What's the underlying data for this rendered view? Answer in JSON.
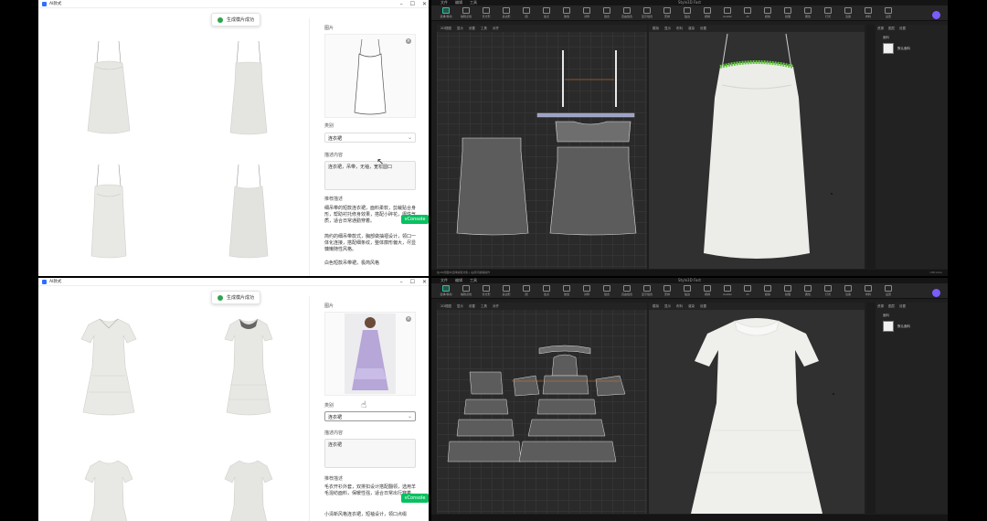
{
  "top": {
    "ai": {
      "title": "AI款式",
      "toast": "生成模片成功",
      "image_label": "图片",
      "category_label": "类别",
      "category_value": "连衣裙",
      "desc_label": "描述内容",
      "desc_value": "连衣裙，吊带，无袖，宽松圆口",
      "rec_label": "推荐描述",
      "rec_texts": [
        "细吊带的短款连衣裙，面料柔软，剪裁贴合身形，帮助衬托修身效果，搭配小碎花，很性气质，适合日常通勤穿着。",
        "简约的细吊带款式，胸部做抽褶设计，领口一体化连接，搭配细条纹，整体廓形偏大，尽显慵懒随性风格。",
        "白色短款吊带裙，极简风格"
      ],
      "vconsole": "vConsole"
    },
    "editor": {
      "title": "Style3D Fast",
      "tabs": [
        "文件",
        "编辑",
        "工具"
      ],
      "tools": [
        "选择/移动",
        "编辑点线",
        "长方形",
        "多边形",
        "圆",
        "加点",
        "放缝",
        "对称",
        "缝合",
        "自由缝合",
        "显示缝合",
        "安排",
        "贴边",
        "褶裥",
        "Avatar",
        "AI",
        "模拟",
        "纹理",
        "属性",
        "灯光",
        "渲染",
        "布料",
        "设置"
      ],
      "pattern_view_tools": [
        "2D视图",
        "显示",
        "设置",
        "工具",
        "对齐"
      ],
      "view3d_tools": [
        "模拟",
        "显示",
        "布料",
        "渲染",
        "设置"
      ],
      "panel_tabs": [
        "资源",
        "图层",
        "设置"
      ],
      "panel_sub": "面料",
      "fabric_item": "默认面料",
      "status_left": "在2D视图中选择编辑对象 | 右键可撤销操作",
      "status_right": "UID:xxxx"
    }
  },
  "bottom": {
    "ai": {
      "title": "AI款式",
      "toast": "生成模片成功",
      "image_label": "图片",
      "category_label": "类别",
      "category_value": "连衣裙",
      "desc_label": "描述内容",
      "desc_value": "连衣裙",
      "rec_label": "推荐描述",
      "rec_texts": [
        "毛衣开衫外套，双排扣设计搭配翻领，选用羊毛混纺面料，保暖性强，适合日常出行穿着。",
        "小清新风格连衣裙，短袖设计，领口点缀"
      ],
      "vconsole": "vConsole"
    },
    "editor": {
      "title": "Style3D Fast",
      "tabs": [
        "文件",
        "编辑",
        "工具"
      ],
      "tools": [
        "选择/移动",
        "编辑点线",
        "长方形",
        "多边形",
        "圆",
        "加点",
        "放缝",
        "对称",
        "缝合",
        "自由缝合",
        "显示缝合",
        "安排",
        "贴边",
        "褶裥",
        "Avatar",
        "AI",
        "模拟",
        "纹理",
        "属性",
        "灯光",
        "渲染",
        "布料",
        "设置"
      ],
      "pattern_view_tools": [
        "2D视图",
        "显示",
        "设置",
        "工具",
        "对齐"
      ],
      "view3d_tools": [
        "模拟",
        "显示",
        "布料",
        "渲染",
        "设置"
      ],
      "panel_tabs": [
        "资源",
        "图层",
        "设置"
      ],
      "panel_sub": "面料",
      "fabric_item": "默认面料",
      "status_left": "",
      "status_right": ""
    }
  },
  "colors": {
    "accent_green": "#2fc2a3",
    "toast_green": "#2ea44f",
    "vconsole_green": "#07c160",
    "avatar_purple": "#7b5cff"
  }
}
